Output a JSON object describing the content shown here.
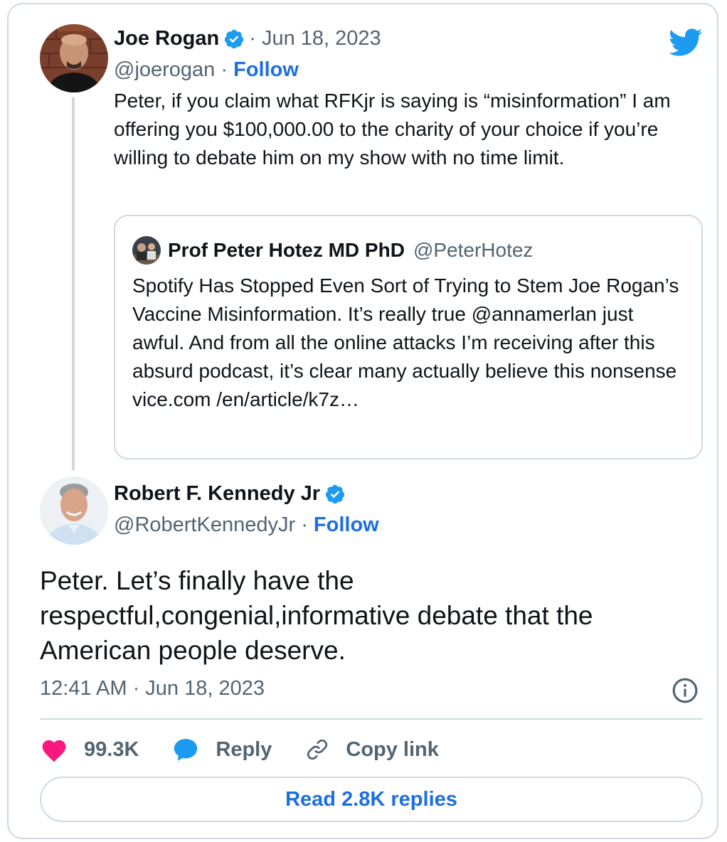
{
  "tweet1": {
    "author_name": "Joe Rogan",
    "date": "· Jun 18, 2023",
    "handle": "@joerogan",
    "separator": "·",
    "follow_label": "Follow",
    "text": "Peter, if you claim what RFKjr is saying is “misinformation” I am offering you $100,000.00 to the charity of your choice if you’re willing to debate him on my show with no time limit."
  },
  "quote": {
    "author_name": "Prof Peter Hotez MD PhD",
    "handle": "@PeterHotez",
    "text": "Spotify Has Stopped Even Sort of Trying to Stem Joe Rogan’s Vaccine Misinformation. It’s really true @annamerlan just awful. And from all the online attacks I’m receiving after this absurd podcast, it’s clear many actually believe this nonsense vice.com /en/article/k7z…"
  },
  "tweet2": {
    "author_name": "Robert F. Kennedy Jr",
    "handle": "@RobertKennedyJr",
    "separator": "·",
    "follow_label": "Follow",
    "text": "Peter. Let’s finally have the respectful,congenial,informative debate that the American people deserve.",
    "timestamp": "12:41 AM · Jun 18, 2023"
  },
  "actions": {
    "likes": "99.3K",
    "reply_label": "Reply",
    "copy_link_label": "Copy link"
  },
  "read_replies_label": "Read 2.8K replies",
  "colors": {
    "link_blue": "#1d6fe0",
    "verified_blue": "#1d9bf0",
    "heart": "#f91880",
    "border": "#cfd9de",
    "secondary_text": "#536471"
  },
  "icons": [
    "verified-badge-icon",
    "twitter-bird-icon",
    "info-icon",
    "heart-icon",
    "reply-bubble-icon",
    "link-icon"
  ]
}
